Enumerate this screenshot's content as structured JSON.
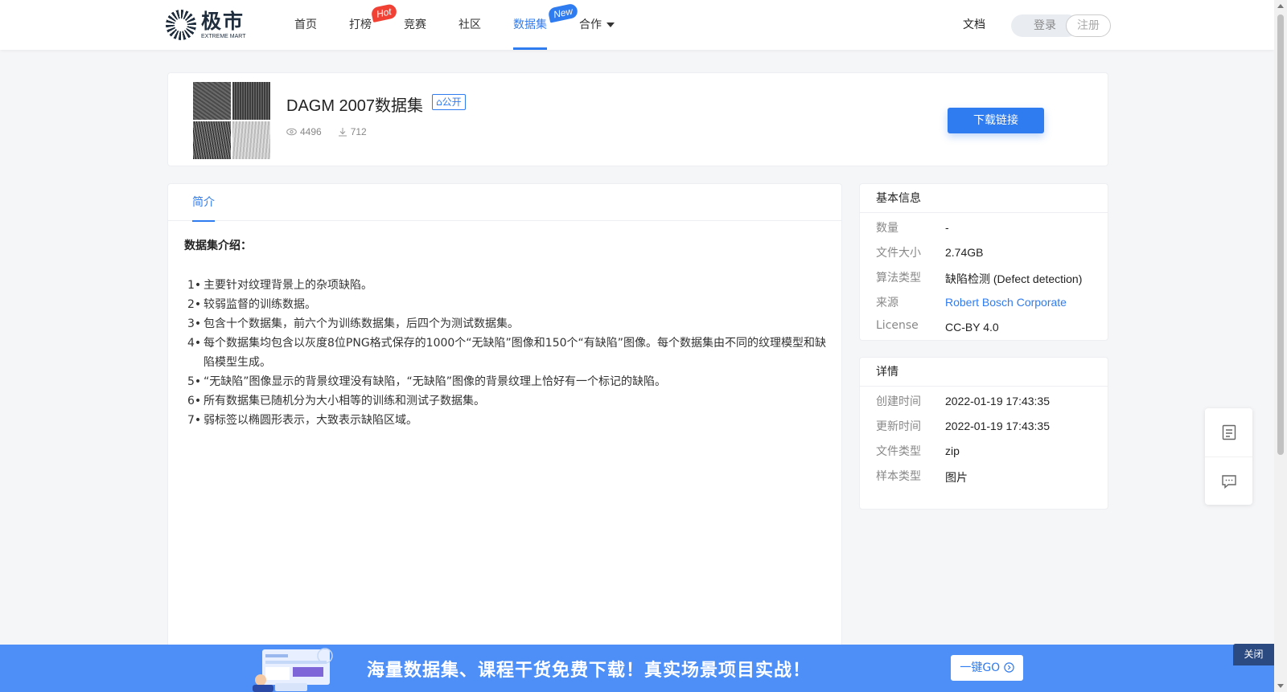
{
  "header": {
    "logo_cn": "极市",
    "logo_en": "EXTREME MART",
    "nav": [
      {
        "label": "首页",
        "badge": ""
      },
      {
        "label": "打榜",
        "badge": "Hot"
      },
      {
        "label": "竞赛",
        "badge": ""
      },
      {
        "label": "社区",
        "badge": ""
      },
      {
        "label": "数据集",
        "badge": "New"
      },
      {
        "label": "合作",
        "badge": ""
      }
    ],
    "docs_label": "文档",
    "login_label": "登录",
    "register_label": "注册"
  },
  "dataset": {
    "title": "DAGM 2007数据集",
    "visibility": "公开",
    "views": "4496",
    "downloads": "712",
    "download_button": "下载链接"
  },
  "content": {
    "tab_label": "简介",
    "intro_heading": "数据集介绍：",
    "intro_items": [
      {
        "num": "1•",
        "text": "主要针对纹理背景上的杂项缺陷。"
      },
      {
        "num": "2•",
        "text": "较弱监督的训练数据。"
      },
      {
        "num": "3•",
        "text": "包含十个数据集，前六个为训练数据集，后四个为测试数据集。"
      },
      {
        "num": "4•",
        "text": "每个数据集均包含以灰度8位PNG格式保存的1000个“无缺陷”图像和150个“有缺陷”图像。每个数据集由不同的纹理模型和缺陷模型生成。"
      },
      {
        "num": "5•",
        "text": "“无缺陷”图像显示的背景纹理没有缺陷，“无缺陷”图像的背景纹理上恰好有一个标记的缺陷。"
      },
      {
        "num": "6•",
        "text": "所有数据集已随机分为大小相等的训练和测试子数据集。"
      },
      {
        "num": "7•",
        "text": "弱标签以椭圆形表示，大致表示缺陷区域。"
      }
    ]
  },
  "basic_info": {
    "title": "基本信息",
    "rows": [
      {
        "key": "数量",
        "value": "-"
      },
      {
        "key": "文件大小",
        "value": "2.74GB"
      },
      {
        "key": "算法类型",
        "value": "缺陷检测 (Defect detection)"
      },
      {
        "key": "来源",
        "value": "Robert Bosch Corporate"
      },
      {
        "key": "License",
        "value": "CC-BY 4.0"
      }
    ]
  },
  "details": {
    "title": "详情",
    "rows": [
      {
        "key": "创建时间",
        "value": "2022-01-19 17:43:35"
      },
      {
        "key": "更新时间",
        "value": "2022-01-19 17:43:35"
      },
      {
        "key": "文件类型",
        "value": "zip"
      },
      {
        "key": "样本类型",
        "value": "图片"
      }
    ]
  },
  "banner": {
    "text": "海量数据集、课程干货免费下载！真实场景项目实战！",
    "go_label": "一键GO",
    "close_label": "关闭"
  },
  "colors": {
    "accent": "#2f7bf0",
    "banner": "#4d8ff6",
    "hot_badge": "#f04134"
  }
}
